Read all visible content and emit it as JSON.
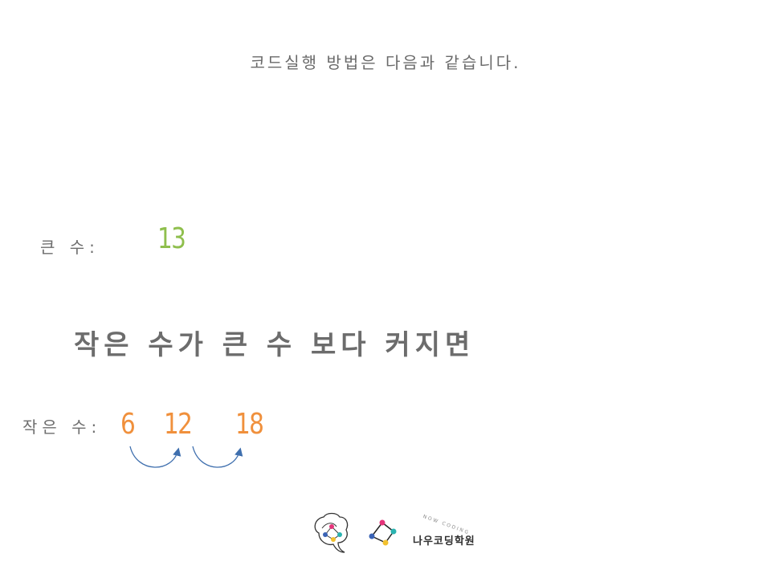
{
  "title": "코드실행 방법은 다음과 같습니다.",
  "big": {
    "label": "큰 수:",
    "value": "13"
  },
  "condition": "작은 수가 큰 수 보다 커지면",
  "small": {
    "label": "작은 수:",
    "values": [
      "6",
      "12",
      "18"
    ]
  },
  "colors": {
    "big_value": "#8fbf4d",
    "small_values": "#f0903c",
    "arrow": "#3f6fae",
    "text": "#6c6c6c"
  },
  "logo": {
    "name": "나우코딩학원",
    "tagline": "NOW CODING"
  }
}
